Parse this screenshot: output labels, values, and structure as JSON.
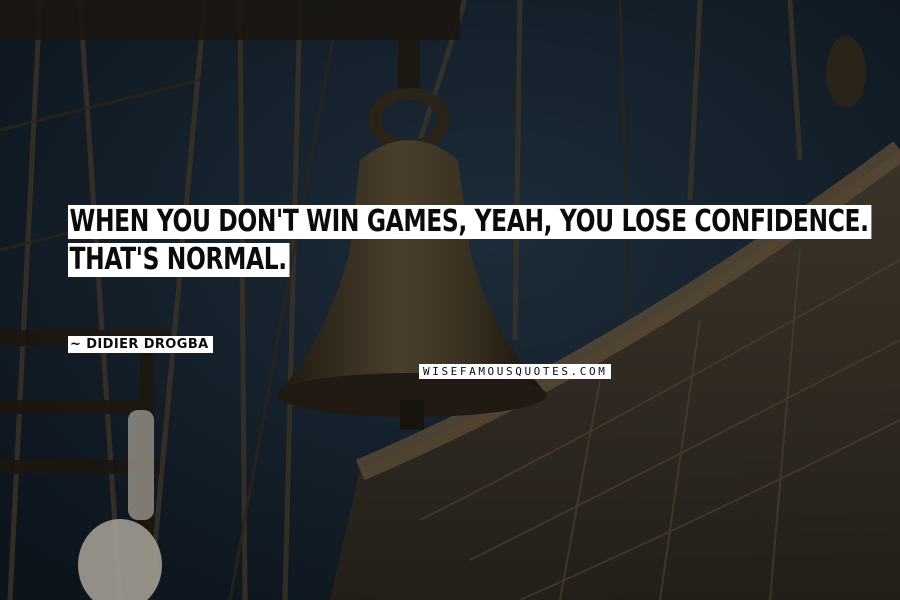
{
  "quote": {
    "line1": "WHEN YOU DON'T WIN GAMES, YEAH, YOU LOSE CONFIDENCE.",
    "line2": "THAT'S NORMAL."
  },
  "author": "~ DIDIER DROGBA",
  "watermark": "WISEFAMOUSQUOTES.COM",
  "colors": {
    "background": "#101a24",
    "text_box": "#ffffff",
    "text": "#0b0b0b"
  }
}
